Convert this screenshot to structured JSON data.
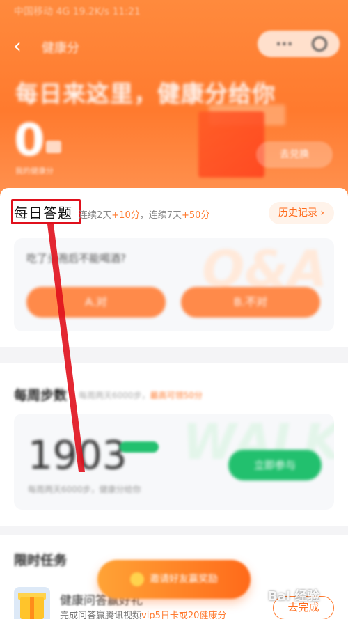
{
  "status_bar": {
    "text": "中国移动 4G 19.2K/s 11:21"
  },
  "header": {
    "back_icon": "chevron-left-icon",
    "title": "健康分",
    "headline": "每日来这里，健康分给你",
    "score": "0",
    "score_caption": "我的健康分",
    "link_label": "去兑换"
  },
  "daily_quiz": {
    "title": "每日答题",
    "tip_prefix": "连续2天",
    "tip_bonus1": "+10分",
    "tip_mid": "，连续7天",
    "tip_bonus2": "+50分",
    "history_label": "历史记录",
    "watermark": "Q&A",
    "question": "吃了头孢后不能喝酒?",
    "answer_a": "A.对",
    "answer_b": "B.不对"
  },
  "weekly_steps": {
    "title": "每周步数",
    "tip": "每周两天6000步，",
    "tip_accent": "最高可领50分",
    "watermark": "WALK",
    "steps": "1903",
    "sub": "每周两天6000步，健康分给你",
    "button_label": "立即参与"
  },
  "limited_tasks": {
    "title": "限时任务",
    "task_name": "健康问答赢好礼",
    "task_desc_prefix": "完成问答赢腾讯视频",
    "task_desc_accent": "vip5日卡或20健康分",
    "task_button": "去完成"
  },
  "floating_button": {
    "label": "邀请好友赢奖励"
  },
  "watermark": "Bai 经验",
  "colors": {
    "accent": "#ff7a2e",
    "green": "#22c06e",
    "annotation": "#e0101c"
  }
}
